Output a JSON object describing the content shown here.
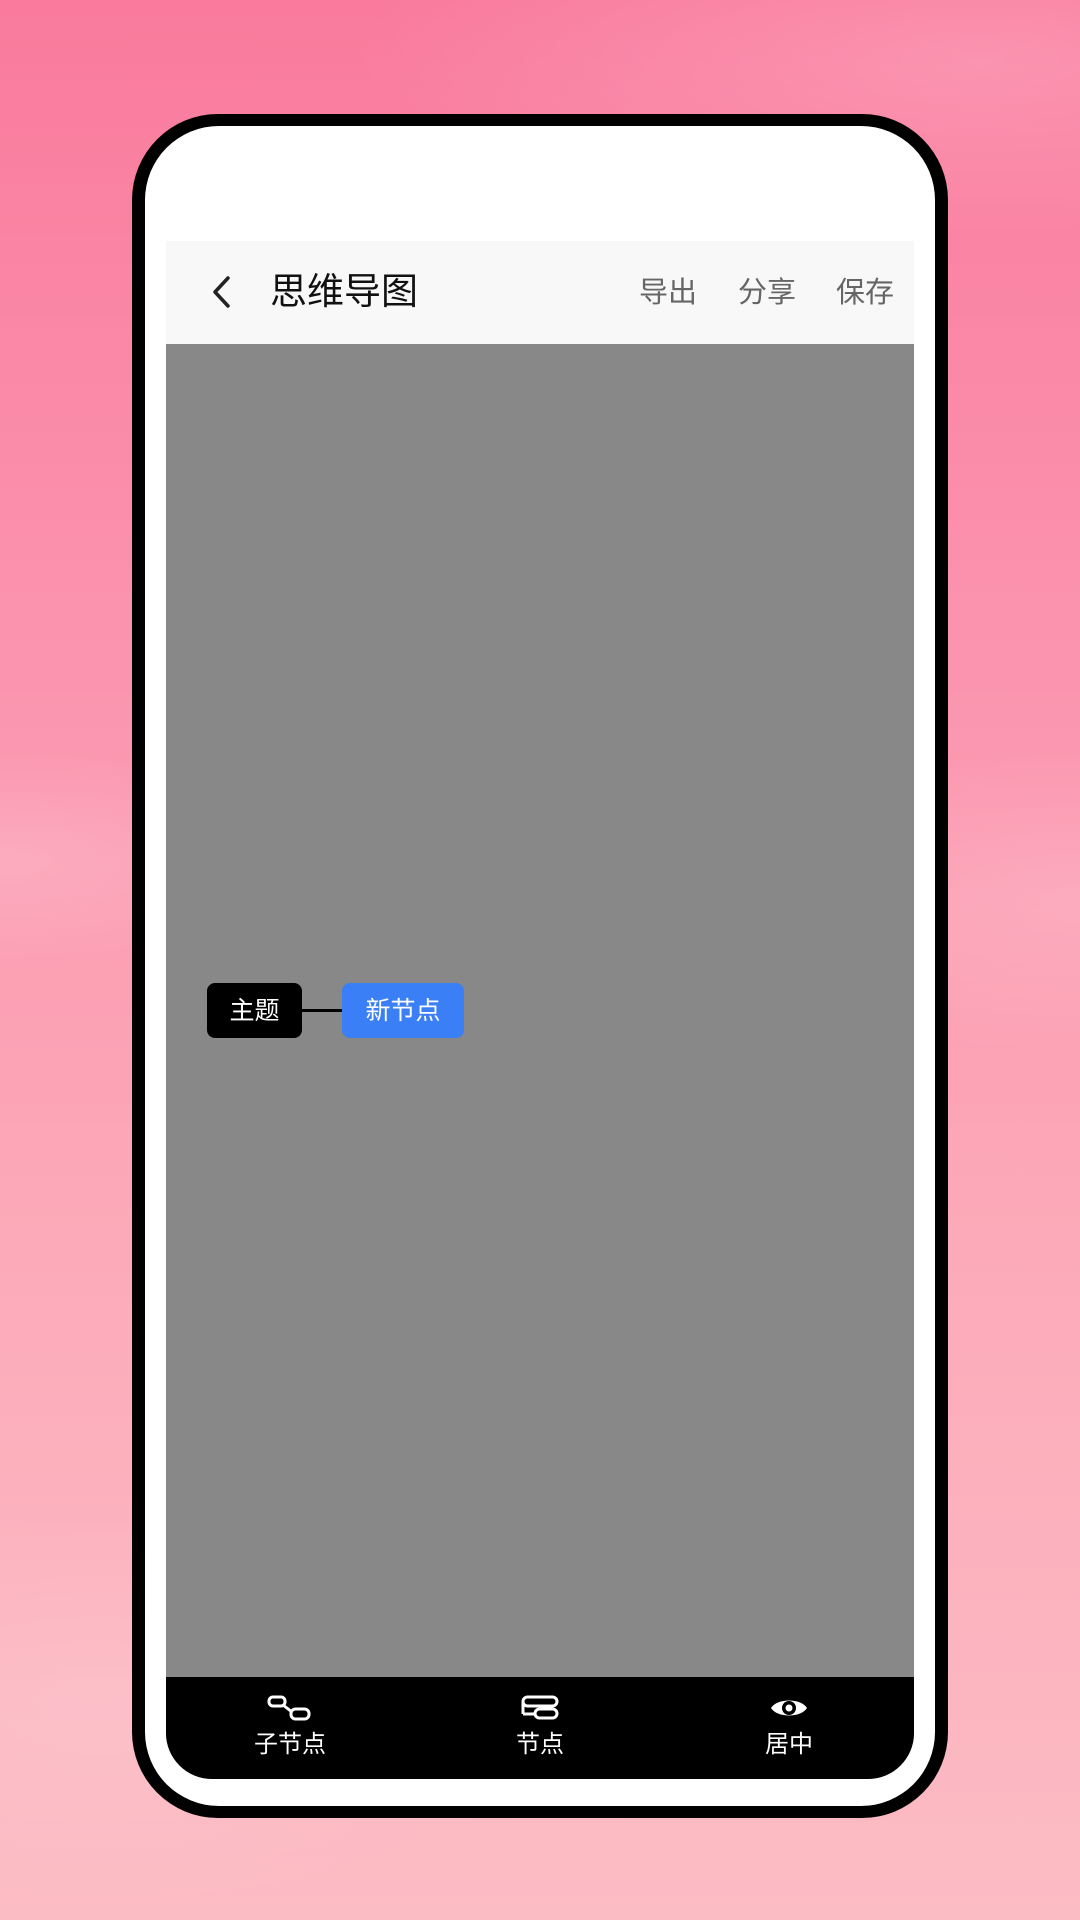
{
  "header": {
    "title": "思维导图",
    "actions": {
      "export": "导出",
      "share": "分享",
      "save": "保存"
    }
  },
  "canvas": {
    "background": "#888888",
    "root_node": {
      "label": "主题",
      "color": "#000000"
    },
    "child_node": {
      "label": "新节点",
      "color": "#3a7ff6"
    }
  },
  "toolbar": {
    "items": [
      {
        "label": "子节点",
        "icon": "child-node-icon"
      },
      {
        "label": "节点",
        "icon": "sibling-node-icon"
      },
      {
        "label": "居中",
        "icon": "eye-icon"
      }
    ]
  }
}
